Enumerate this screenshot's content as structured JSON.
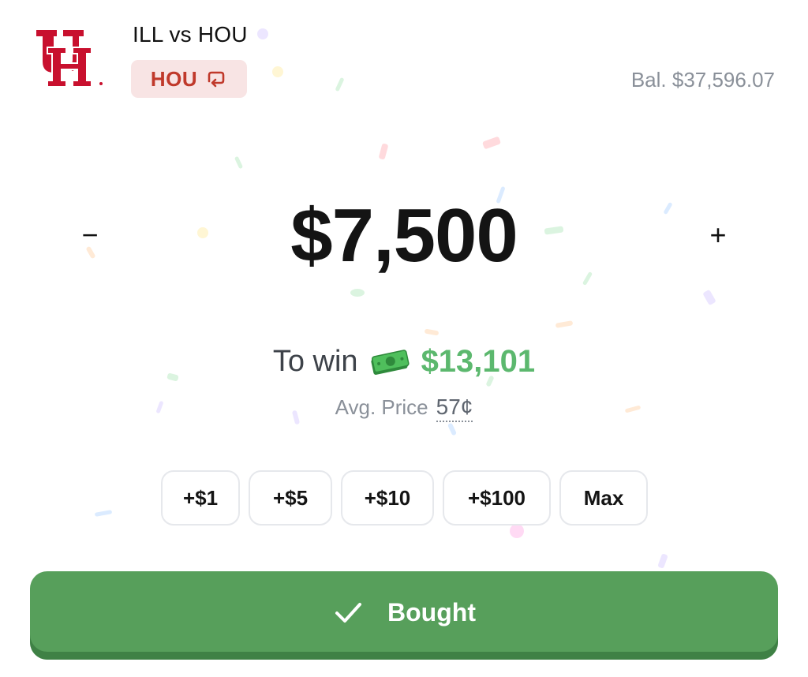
{
  "header": {
    "logo_icon": "university-of-houston-logo",
    "matchup": "ILL vs HOU",
    "selected_team": "HOU",
    "swap_icon": "swap-team-icon",
    "balance": "Bal. $37,596.07"
  },
  "amount": {
    "minus_label": "−",
    "value": "$7,500",
    "plus_label": "+"
  },
  "payout": {
    "label": "To win",
    "icon": "money-icon",
    "value": "$13,101",
    "avg_label": "Avg. Price",
    "avg_value": "57¢"
  },
  "quick_add": [
    "+$1",
    "+$5",
    "+$10",
    "+$100",
    "Max"
  ],
  "action": {
    "icon": "check-icon",
    "label": "Bought"
  },
  "colors": {
    "team": "#c0392b",
    "team_chip_bg": "#f8e4e4",
    "win_green": "#5cb86e",
    "bought_green": "#579f5b"
  }
}
